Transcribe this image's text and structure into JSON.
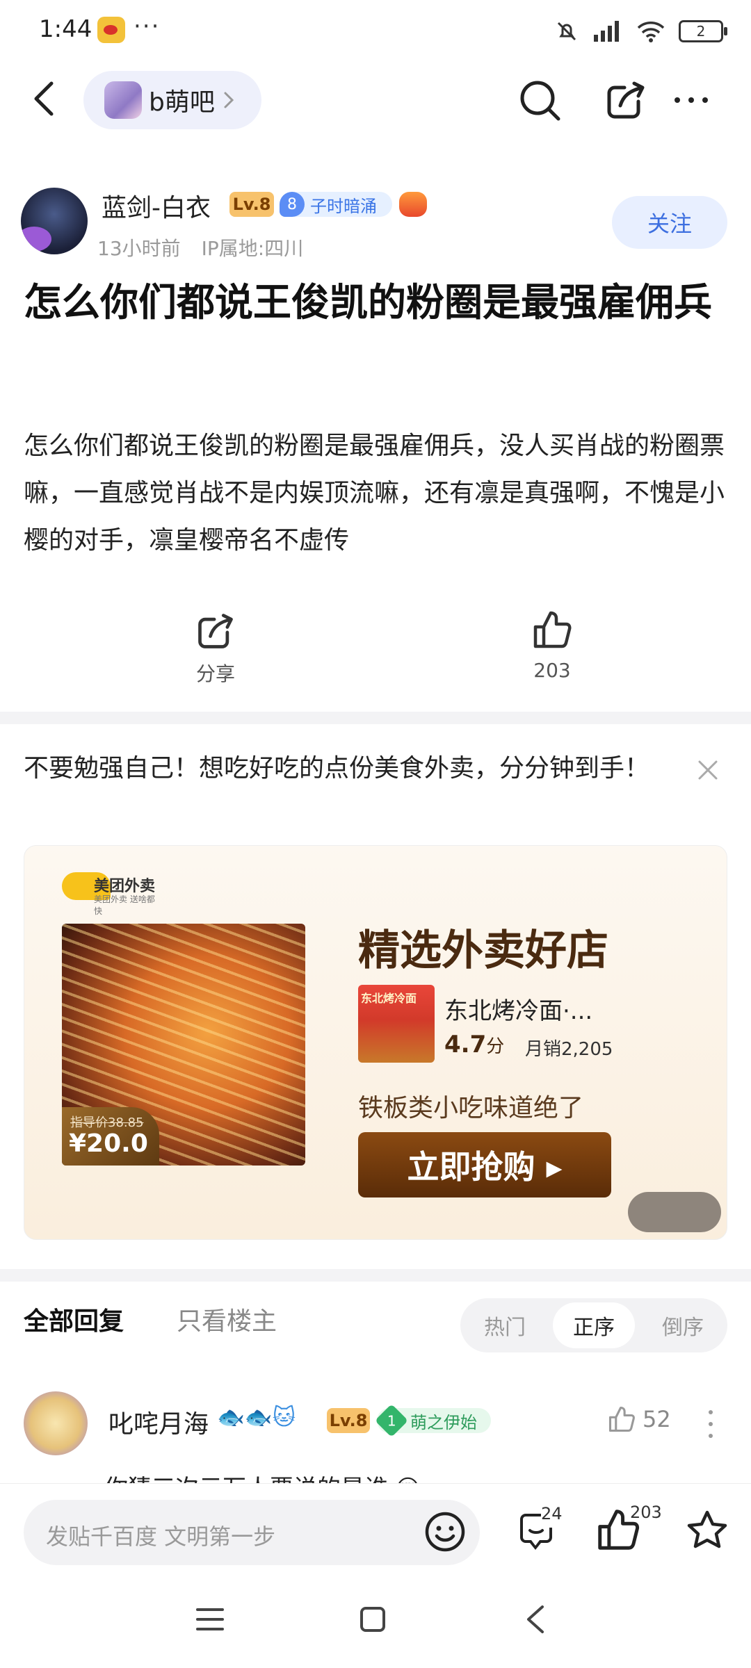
{
  "status": {
    "time": "1:44",
    "more": "···",
    "battery": "2"
  },
  "nav": {
    "forum_name": "b萌吧"
  },
  "post": {
    "author": "蓝剑-白衣",
    "level": "Lv.8",
    "title_badge_num": "8",
    "title_badge": "子时暗涌",
    "time_ago": "13小时前",
    "ip": "IP属地:四川",
    "follow": "关注",
    "title": "怎么你们都说王俊凯的粉圈是最强雇佣兵",
    "body": "怎么你们都说王俊凯的粉圈是最强雇佣兵，没人买肖战的粉圈票嘛，一直感觉肖战不是内娱顶流嘛，还有凛是真强啊，不愧是小樱的对手，凛皇樱帝名不虚传",
    "share_label": "分享",
    "like_count": "203"
  },
  "ad": {
    "text": "不要勉强自己！想吃好吃的点份美食外卖，分分钟到手！",
    "logo_text": "美团外卖",
    "logo_sub": "美团外卖 送啥都快",
    "old_price": "指导价38.85",
    "new_price": "¥20.0",
    "heading": "精选外卖好店",
    "shop_img_text": "东北烤冷面",
    "shop_name": "东北烤冷面·...",
    "rating": "4.7",
    "rating_unit": "分",
    "sales": "月销2,205",
    "slogan": "铁板类小吃味道绝了",
    "buy": "立即抢购 ▸"
  },
  "replies": {
    "tab_all": "全部回复",
    "tab_host": "只看楼主",
    "sort": [
      "热门",
      "正序",
      "倒序"
    ],
    "sort_active": 1,
    "first": {
      "name": "叱咤月海",
      "emojis": "🐟🐟🐱",
      "level": "Lv.8",
      "badge_num": "1",
      "badge": "萌之伊始",
      "likes": "52",
      "text": "你猜三次元万人票说的是谁 😔"
    }
  },
  "bottom": {
    "placeholder": "发贴千百度 文明第一步",
    "comment_count": "24",
    "like_count": "203"
  },
  "colors": {
    "accent": "#3d6fe0",
    "level": "#f7c26c",
    "ad_brown": "#5a2c08"
  }
}
